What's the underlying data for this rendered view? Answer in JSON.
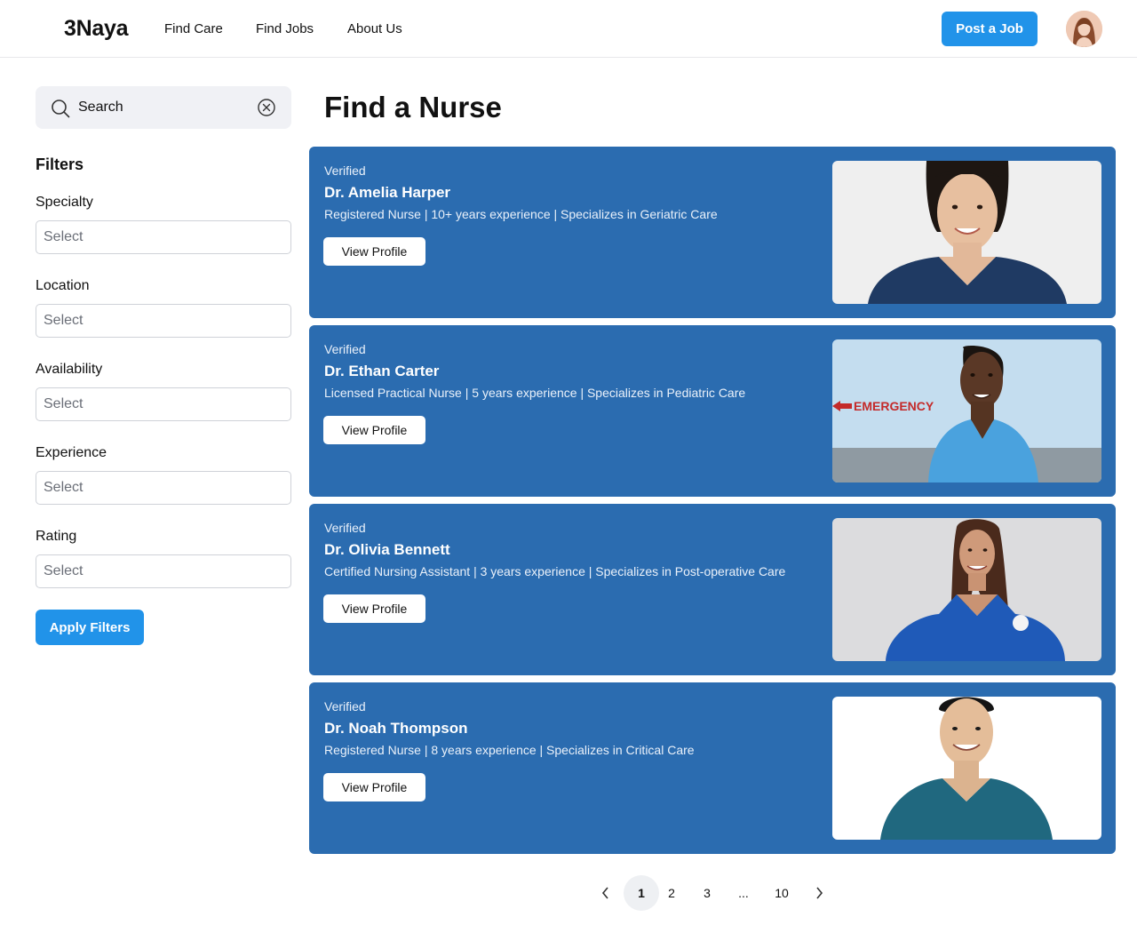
{
  "header": {
    "logo": "3Naya",
    "nav": [
      "Find Care",
      "Find Jobs",
      "About Us"
    ],
    "post_button": "Post a Job",
    "avatar_icon": "user-avatar"
  },
  "sidebar": {
    "search_placeholder": "Search",
    "filters_title": "Filters",
    "filters": [
      {
        "label": "Specialty",
        "value": "Select"
      },
      {
        "label": "Location",
        "value": "Select"
      },
      {
        "label": "Availability",
        "value": "Select"
      },
      {
        "label": "Experience",
        "value": "Select"
      },
      {
        "label": "Rating",
        "value": "Select"
      }
    ],
    "apply_button": "Apply Filters"
  },
  "main": {
    "title": "Find a Nurse",
    "cards": [
      {
        "badge": "Verified",
        "name": "Dr. Amelia Harper",
        "desc": "Registered Nurse | 10+ years experience | Specializes in Geriatric Care",
        "button": "View Profile"
      },
      {
        "badge": "Verified",
        "name": "Dr. Ethan Carter",
        "desc": "Licensed Practical Nurse | 5 years experience | Specializes in Pediatric Care",
        "button": "View Profile",
        "photo_sign": "EMERGENCY"
      },
      {
        "badge": "Verified",
        "name": "Dr. Olivia Bennett",
        "desc": "Certified Nursing Assistant | 3 years experience | Specializes in Post-operative Care",
        "button": "View Profile"
      },
      {
        "badge": "Verified",
        "name": "Dr. Noah Thompson",
        "desc": "Registered Nurse | 8 years experience | Specializes in Critical Care",
        "button": "View Profile"
      }
    ]
  },
  "pagination": {
    "prev_icon": "chevron-left-icon",
    "pages": [
      "1",
      "2",
      "3",
      "...",
      "10"
    ],
    "current": "1",
    "next_icon": "chevron-right-icon"
  },
  "colors": {
    "accent": "#2193e9",
    "card_bg": "#2b6cb0"
  }
}
